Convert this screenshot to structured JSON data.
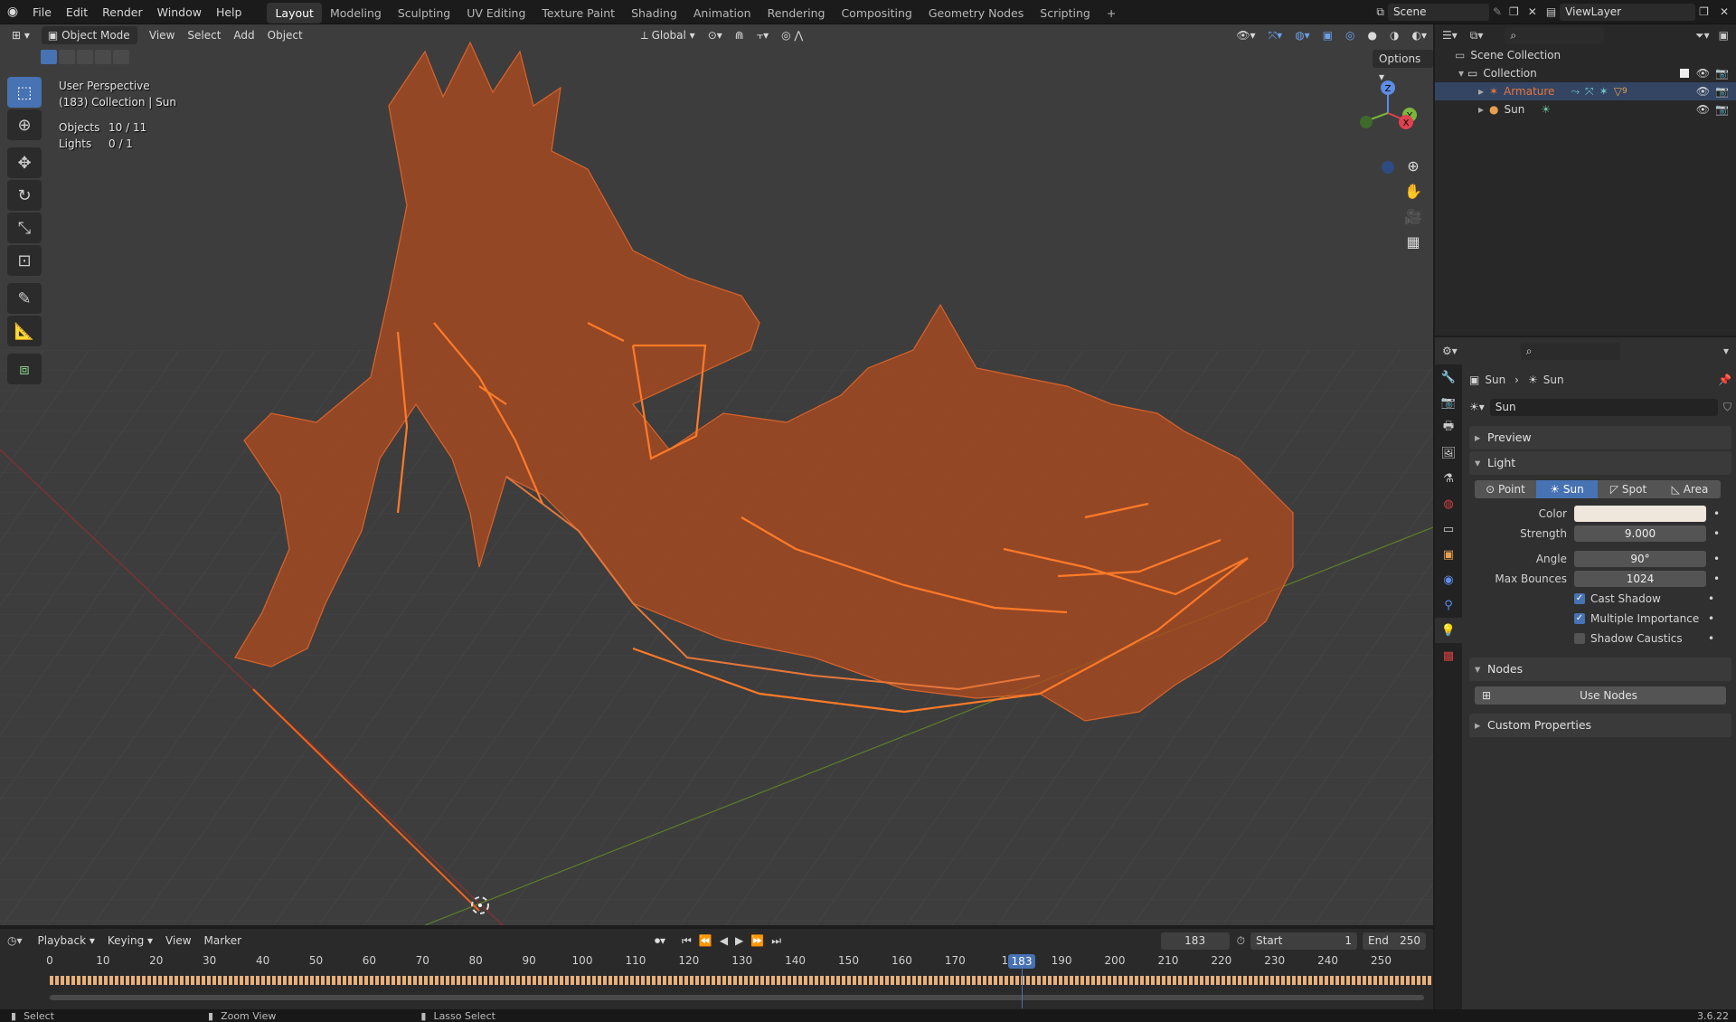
{
  "topbar": {
    "menus": [
      "File",
      "Edit",
      "Render",
      "Window",
      "Help"
    ],
    "workspaces": [
      "Layout",
      "Modeling",
      "Sculpting",
      "UV Editing",
      "Texture Paint",
      "Shading",
      "Animation",
      "Rendering",
      "Compositing",
      "Geometry Nodes",
      "Scripting"
    ],
    "active_workspace": "Layout",
    "add_tab": "+",
    "scene": "Scene",
    "view_layer": "ViewLayer"
  },
  "viewport": {
    "mode": "Object Mode",
    "menus": [
      "View",
      "Select",
      "Add",
      "Object"
    ],
    "orientation": "Global",
    "options": "Options",
    "overlay": {
      "title": "User Perspective",
      "subtitle": "(183) Collection | Sun",
      "objects_label": "Objects",
      "objects_value": "10 / 11",
      "lights_label": "Lights",
      "lights_value": "0 / 1"
    },
    "gizmo": {
      "z": "Z",
      "y": "Y",
      "x": "X"
    }
  },
  "outliner": {
    "search_placeholder": "",
    "root": "Scene Collection",
    "collection": "Collection",
    "items": [
      {
        "name": "Armature",
        "color": "#e8753a"
      },
      {
        "name": "Sun",
        "color": "#d4d4d4"
      }
    ],
    "armature_count": "9"
  },
  "properties": {
    "breadcrumb_object": "Sun",
    "breadcrumb_data": "Sun",
    "datablock": "Sun",
    "panels": {
      "preview": "Preview",
      "light": "Light",
      "nodes": "Nodes",
      "custom": "Custom Properties"
    },
    "light_types": [
      "Point",
      "Sun",
      "Spot",
      "Area"
    ],
    "active_type": "Sun",
    "fields": [
      {
        "label": "Color",
        "value": ""
      },
      {
        "label": "Strength",
        "value": "9.000"
      },
      {
        "label": "Angle",
        "value": "90°"
      },
      {
        "label": "Max Bounces",
        "value": "1024"
      }
    ],
    "checks": [
      {
        "label": "Cast Shadow",
        "checked": true
      },
      {
        "label": "Multiple Importance",
        "checked": true
      },
      {
        "label": "Shadow Caustics",
        "checked": false
      }
    ],
    "use_nodes": "Use Nodes",
    "light_color": "#efe6dc"
  },
  "timeline": {
    "menus": [
      "Playback",
      "Keying",
      "View",
      "Marker"
    ],
    "current_frame": "183",
    "start_label": "Start",
    "start": "1",
    "end_label": "End",
    "end": "250",
    "ticks": [
      "0",
      "10",
      "20",
      "30",
      "40",
      "50",
      "60",
      "70",
      "80",
      "90",
      "100",
      "110",
      "120",
      "130",
      "140",
      "150",
      "160",
      "170",
      "18",
      "190",
      "200",
      "210",
      "220",
      "230",
      "240",
      "250"
    ],
    "playhead": "183"
  },
  "status": {
    "select": "Select",
    "zoom": "Zoom View",
    "lasso": "Lasso Select",
    "version": "3.6.22"
  },
  "colors": {
    "accent": "#4772b3",
    "selected": "#e8753a",
    "wire": "#d2541e"
  }
}
